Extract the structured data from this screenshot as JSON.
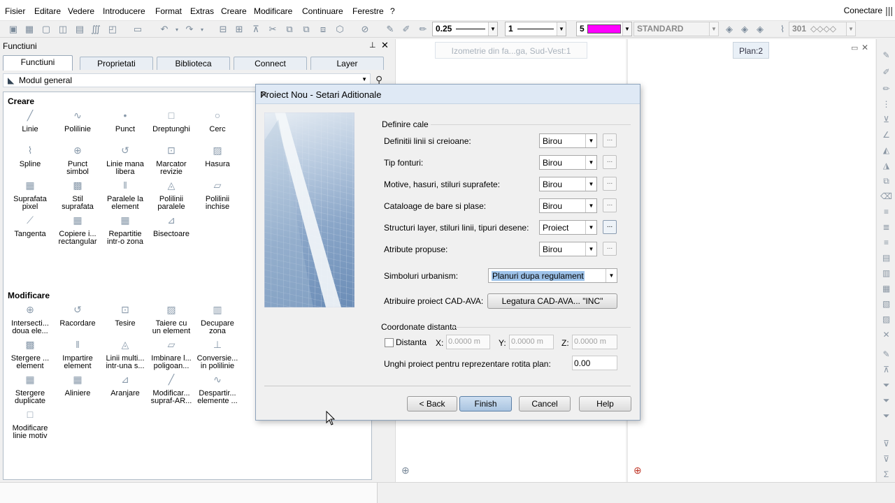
{
  "menu": [
    "Fisier",
    "Editare",
    "Vedere",
    "Introducere",
    "Format",
    "Extras",
    "Creare",
    "Modificare",
    "Continuare",
    "Ferestre",
    "?"
  ],
  "connect_label": "Conectare",
  "toolbar": {
    "pen_value": "0.25",
    "line_value": "1",
    "color_value": "5",
    "color_swatch": "#ff00ff",
    "style_value": "STANDARD",
    "layer_value": "301"
  },
  "panel": {
    "title": "Functiuni",
    "tabs": [
      "Functiuni",
      "Proprietati",
      "Biblioteca",
      "Connect",
      "Layer"
    ],
    "module": "Modul general",
    "section_create": "Creare",
    "create_tools": [
      [
        "Linie",
        ""
      ],
      [
        "Polilinie",
        ""
      ],
      [
        "Punct",
        ""
      ],
      [
        "Dreptunghi",
        ""
      ],
      [
        "Cerc",
        ""
      ],
      [
        "P",
        ""
      ],
      [
        "Spline",
        ""
      ],
      [
        "Punct",
        "simbol"
      ],
      [
        "Linie mana",
        "libera"
      ],
      [
        "Marcator",
        "revizie"
      ],
      [
        "Hasura",
        ""
      ],
      [
        "M",
        ""
      ],
      [
        "Suprafata",
        "pixel"
      ],
      [
        "Stil",
        "suprafata"
      ],
      [
        "Paralele la",
        "element"
      ],
      [
        "Polilinii",
        "paralele"
      ],
      [
        "Polilinii",
        "inchise"
      ],
      [
        "Perp",
        ""
      ],
      [
        "Tangenta",
        ""
      ],
      [
        "Copiere i...",
        "rectangular"
      ],
      [
        "Repartitie",
        "intr-o zona"
      ],
      [
        "Bisectoare",
        ""
      ]
    ],
    "section_modify": "Modificare",
    "modify_tools": [
      [
        "Intersecti...",
        "doua ele..."
      ],
      [
        "Racordare",
        ""
      ],
      [
        "Tesire",
        ""
      ],
      [
        "Taiere cu",
        "un element"
      ],
      [
        "Decupare",
        "zona"
      ],
      [
        "St",
        "lini"
      ],
      [
        "Stergere ...",
        "element"
      ],
      [
        "Impartire",
        "element"
      ],
      [
        "Linii multi...",
        "intr-una s..."
      ],
      [
        "Imbinare l...",
        "poligoan..."
      ],
      [
        "Conversie...",
        "in polilinie"
      ],
      [
        "Co",
        "i"
      ],
      [
        "Stergere",
        "duplicate"
      ],
      [
        "Aliniere",
        ""
      ],
      [
        "Aranjare",
        ""
      ],
      [
        "Modificar...",
        "supraf-AR..."
      ],
      [
        "Despartir...",
        "elemente ..."
      ],
      [
        "Uni",
        "el"
      ],
      [
        "Modificare",
        "linie motiv"
      ]
    ]
  },
  "views": {
    "view1_tab": "Izometrie  din  fa...ga,  Sud-Vest:1",
    "view2_tab": "Plan:2"
  },
  "dialog": {
    "title": "Proiect Nou - Setari Aditionale",
    "group_path": "Definire cale",
    "rows": [
      {
        "label": "Definitii linii si creioane:",
        "value": "Birou"
      },
      {
        "label": "Tip fonturi:",
        "value": "Birou"
      },
      {
        "label": "Motive, hasuri, stiluri suprafete:",
        "value": "Birou"
      },
      {
        "label": "Cataloage de bare si plase:",
        "value": "Birou"
      },
      {
        "label": "Structuri layer, stiluri linii, tipuri desene:",
        "value": "Proiect"
      },
      {
        "label": "Atribute propuse:",
        "value": "Birou"
      }
    ],
    "urban_label": "Simboluri urbanism:",
    "urban_value": "Planuri dupa regulament",
    "cad_label": "Atribuire proiect CAD-AVA:",
    "cad_button": "Legatura CAD-AVA... \"INC\"",
    "group_coords": "Coordonate distanta",
    "distance_label": "Distanta",
    "x_label": "X:",
    "x_value": "0.0000 m",
    "y_label": "Y:",
    "y_value": "0.0000 m",
    "z_label": "Z:",
    "z_value": "0.0000 m",
    "angle_label": "Unghi proiect pentru reprezentare rotita plan:",
    "angle_value": "0.00",
    "btn_back": "< Back",
    "btn_finish": "Finish",
    "btn_cancel": "Cancel",
    "btn_help": "Help"
  }
}
